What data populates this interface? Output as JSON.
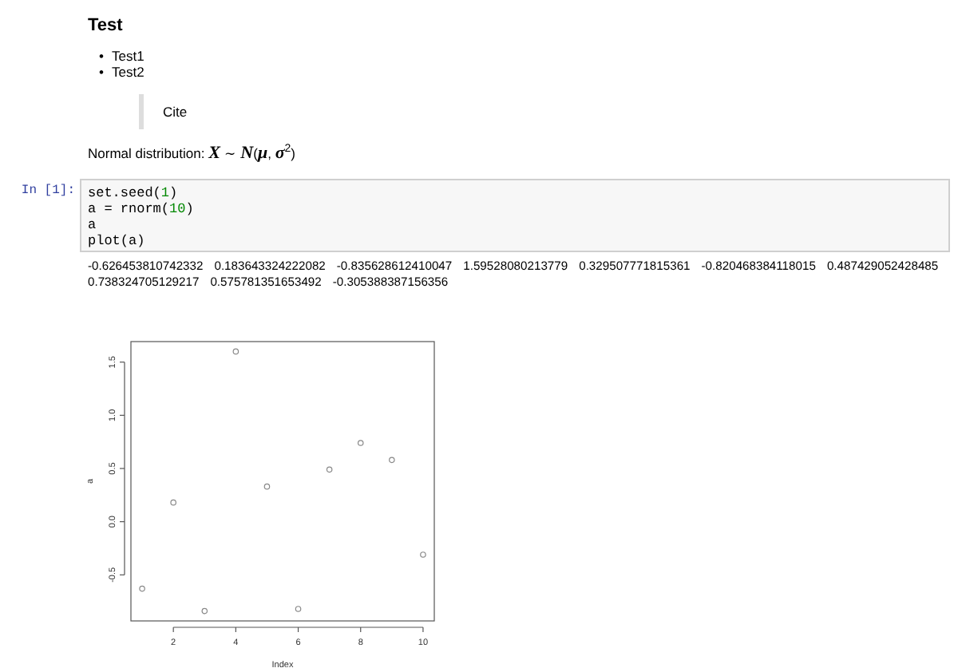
{
  "markdown": {
    "heading": "Test",
    "list": [
      {
        "marker": "•",
        "text": "Test1"
      },
      {
        "marker": "•",
        "text": "Test2"
      }
    ],
    "blockquote": "Cite",
    "formula_line": "Normal distribution: *X* ∼ *N*(*μ*, *σ*$^{2}$)"
  },
  "code_cell": {
    "prompt": "In [1]:",
    "code": [
      "set.seed(1)",
      "a = rnorm(10)",
      "a",
      "plot(a)"
    ],
    "output": [
      "-0.626453810742332",
      "0.183643324222082",
      "-0.835628612410047",
      "1.59528080213779",
      "0.329507771815361",
      "-0.820468384118015",
      "0.487429052428485",
      "0.738324705129217",
      "0.575781351653492",
      "-0.305388387156356"
    ],
    "chart_data": {
      "type": "scatter",
      "xlabel": "Index",
      "ylabel": "a",
      "x": [
        1,
        2,
        3,
        4,
        5,
        6,
        7,
        8,
        9,
        10
      ],
      "series": [
        {
          "color": "#888888",
          "values": [
            -0.63,
            0.18,
            -0.84,
            1.6,
            0.33,
            -0.82,
            0.49,
            0.74,
            0.58,
            -0.31
          ]
        }
      ],
      "xlim": [
        0.64,
        10.36
      ],
      "ylim": [
        -0.933,
        1.693
      ],
      "xticks": [
        2,
        4,
        6,
        8,
        10
      ],
      "yticks": [
        {
          "value": -0.5,
          "label": "-0.5"
        },
        {
          "value": 0,
          "label": "0.0"
        },
        {
          "value": 0.5,
          "label": "0.5"
        },
        {
          "value": 1,
          "label": "1.0"
        },
        {
          "value": 1.5,
          "label": "1.5"
        }
      ]
    }
  }
}
